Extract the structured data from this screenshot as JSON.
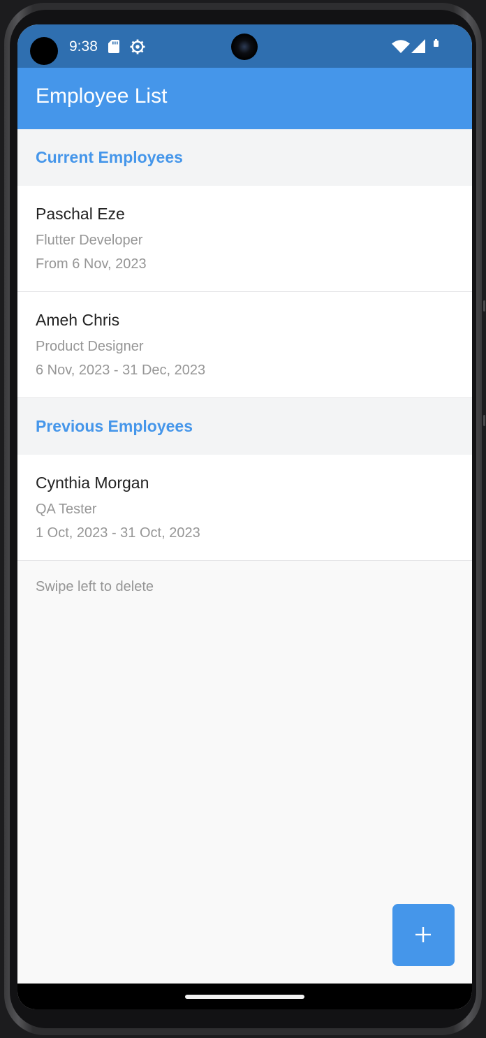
{
  "status_bar": {
    "time": "9:38",
    "icons": [
      "sd-card-icon",
      "settings-gear-icon",
      "wifi-icon",
      "cellular-signal-icon",
      "battery-icon"
    ],
    "color": "#2f6fb0"
  },
  "app_bar": {
    "title": "Employee List",
    "color": "#4596ea"
  },
  "sections": {
    "current": {
      "title": "Current Employees",
      "employees": [
        {
          "name": "Paschal Eze",
          "role": "Flutter Developer",
          "dates": "From 6 Nov, 2023"
        },
        {
          "name": "Ameh Chris",
          "role": "Product Designer",
          "dates": "6 Nov, 2023 - 31 Dec, 2023"
        }
      ]
    },
    "previous": {
      "title": "Previous Employees",
      "employees": [
        {
          "name": "Cynthia Morgan",
          "role": "QA Tester",
          "dates": "1 Oct, 2023 - 31 Oct, 2023"
        }
      ]
    }
  },
  "hint": "Swipe left to delete",
  "fab": {
    "icon": "plus-icon",
    "color": "#4596ea"
  },
  "colors": {
    "accent": "#4596ea",
    "background": "#f9f9f9",
    "secondary_text": "#969696"
  }
}
